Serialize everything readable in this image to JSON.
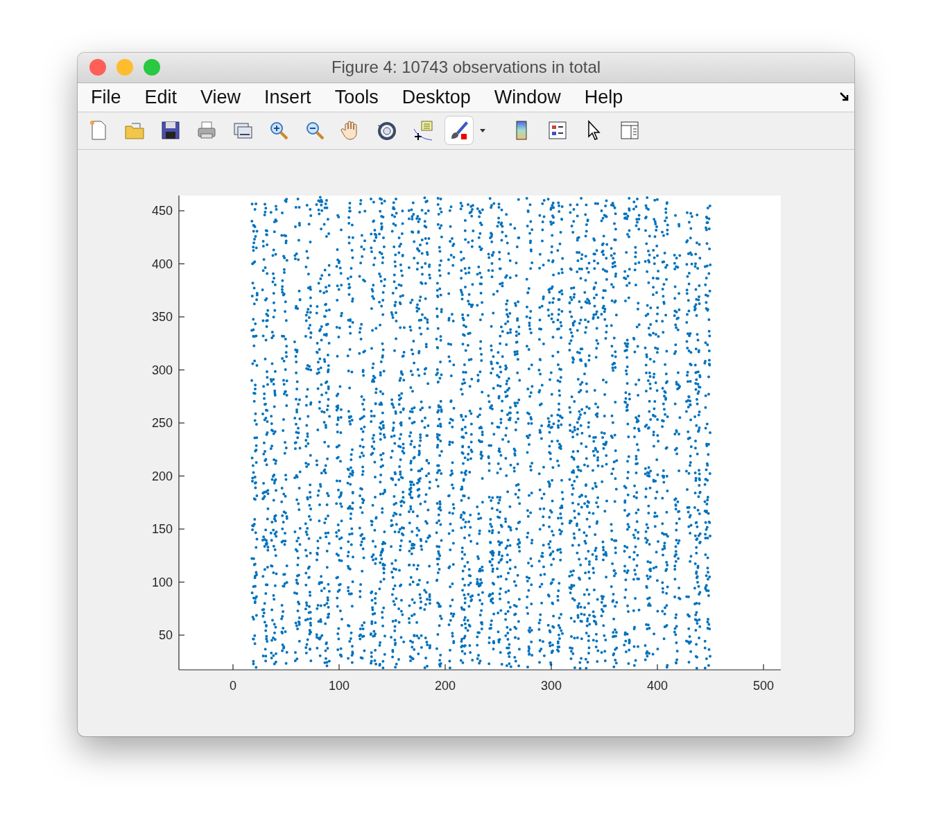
{
  "window": {
    "title": "Figure 4: 10743 observations in total"
  },
  "menu": [
    "File",
    "Edit",
    "View",
    "Insert",
    "Tools",
    "Desktop",
    "Window",
    "Help"
  ],
  "axes": {
    "x_ticks": [
      "0",
      "100",
      "200",
      "300",
      "400",
      "500"
    ],
    "y_ticks": [
      "450",
      "400",
      "350",
      "300",
      "250",
      "200",
      "150",
      "100",
      "50"
    ]
  }
}
